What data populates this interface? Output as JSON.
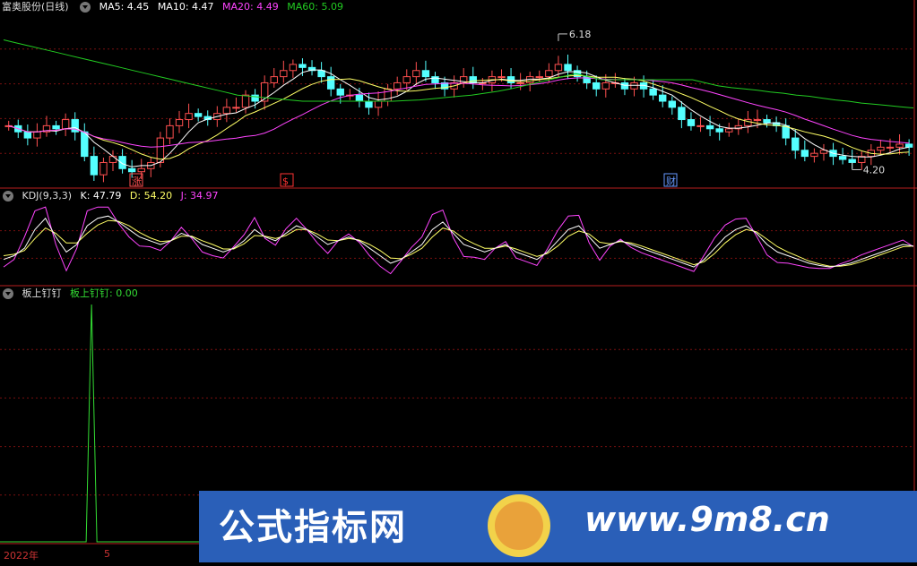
{
  "stock": {
    "name": "富奥股份(日线)"
  },
  "ma": {
    "ma5_label": "MA5: 4.45",
    "ma10_label": "MA10: 4.47",
    "ma20_label": "MA20: 4.49",
    "ma60_label": "MA60: 5.09"
  },
  "kdj": {
    "title": "KDJ(9,3,3)",
    "k_label": "K: 47.79",
    "d_label": "D: 54.20",
    "j_label": "J: 34.97"
  },
  "indicator": {
    "title": "板上钉钉",
    "value_label": "板上钉钉: 0.00"
  },
  "price_markers": {
    "high": "6.18",
    "low": "4.20"
  },
  "event_tags": [
    "涨",
    "$",
    "财"
  ],
  "x_axis": {
    "year": "2022年",
    "month": "5"
  },
  "watermark": {
    "left": "公式指标网",
    "right": "www.9m8.cn"
  },
  "colors": {
    "background": "#000000",
    "up_candle": "#ff5050",
    "down_candle": "#54ffff",
    "ma5": "#ffffff",
    "ma10": "#ffff66",
    "ma20": "#ff44ff",
    "ma60": "#22cc22",
    "kdj_k": "#ffffff",
    "kdj_d": "#ffff66",
    "kdj_j": "#ff44ff",
    "signal": "#33dd33",
    "grid": "#7a1010",
    "panel_border": "#b81e1e"
  },
  "chart_data": {
    "type": "candlestick",
    "price": {
      "close": [
        4.8,
        4.7,
        4.6,
        4.7,
        4.8,
        4.75,
        4.9,
        4.7,
        4.3,
        4.0,
        4.2,
        4.3,
        4.1,
        4.05,
        4.1,
        4.2,
        4.6,
        4.8,
        4.9,
        5.0,
        4.95,
        4.9,
        5.0,
        5.1,
        5.1,
        5.3,
        5.2,
        5.5,
        5.6,
        5.7,
        5.8,
        5.75,
        5.7,
        5.6,
        5.4,
        5.3,
        5.3,
        5.2,
        5.1,
        5.2,
        5.4,
        5.5,
        5.6,
        5.7,
        5.6,
        5.5,
        5.4,
        5.5,
        5.6,
        5.5,
        5.5,
        5.6,
        5.6,
        5.5,
        5.5,
        5.6,
        5.6,
        5.7,
        5.8,
        5.7,
        5.6,
        5.5,
        5.4,
        5.5,
        5.5,
        5.4,
        5.5,
        5.4,
        5.3,
        5.2,
        5.1,
        4.9,
        4.8,
        4.8,
        4.75,
        4.7,
        4.75,
        4.8,
        4.9,
        4.9,
        4.85,
        4.8,
        4.6,
        4.4,
        4.3,
        4.35,
        4.4,
        4.3,
        4.25,
        4.2,
        4.3,
        4.4,
        4.45,
        4.45,
        4.5,
        4.45
      ],
      "ma60": [
        6.2,
        6.15,
        6.1,
        6.05,
        6.0,
        5.95,
        5.9,
        5.85,
        5.8,
        5.75,
        5.7,
        5.65,
        5.6,
        5.55,
        5.5,
        5.45,
        5.4,
        5.35,
        5.3,
        5.28,
        5.26,
        5.24,
        5.22,
        5.2,
        5.2,
        5.2,
        5.2,
        5.2,
        5.2,
        5.2,
        5.2,
        5.21,
        5.22,
        5.24,
        5.26,
        5.28,
        5.3,
        5.33,
        5.36,
        5.4,
        5.45,
        5.5,
        5.55,
        5.6,
        5.65,
        5.6,
        5.55,
        5.55,
        5.55,
        5.55,
        5.55,
        5.55,
        5.55,
        5.55,
        5.5,
        5.45,
        5.42,
        5.4,
        5.38,
        5.35,
        5.33,
        5.3,
        5.28,
        5.25,
        5.22,
        5.2,
        5.17,
        5.15,
        5.13,
        5.11,
        5.09
      ],
      "ylim": [
        3.9,
        6.5
      ],
      "high_marker": 6.18,
      "low_marker": 4.2
    },
    "kdj": {
      "k": [
        30,
        35,
        45,
        70,
        85,
        60,
        40,
        50,
        75,
        85,
        88,
        80,
        70,
        60,
        55,
        50,
        55,
        65,
        60,
        50,
        45,
        40,
        45,
        55,
        70,
        60,
        55,
        65,
        75,
        70,
        60,
        50,
        55,
        60,
        55,
        45,
        35,
        25,
        30,
        40,
        50,
        70,
        80,
        65,
        50,
        45,
        40,
        45,
        50,
        40,
        35,
        30,
        40,
        55,
        70,
        75,
        60,
        45,
        50,
        55,
        50,
        45,
        40,
        35,
        30,
        25,
        20,
        30,
        45,
        60,
        70,
        75,
        65,
        50,
        40,
        35,
        30,
        25,
        22,
        20,
        22,
        25,
        30,
        35,
        40,
        45,
        50,
        48
      ],
      "d": [
        35,
        37,
        42,
        58,
        72,
        65,
        52,
        52,
        65,
        76,
        82,
        81,
        75,
        66,
        59,
        54,
        55,
        61,
        61,
        55,
        50,
        44,
        44,
        51,
        62,
        61,
        58,
        62,
        70,
        70,
        64,
        56,
        55,
        58,
        56,
        50,
        42,
        32,
        31,
        37,
        45,
        60,
        72,
        68,
        58,
        51,
        45,
        45,
        48,
        44,
        39,
        34,
        38,
        48,
        61,
        68,
        64,
        53,
        51,
        54,
        52,
        48,
        43,
        38,
        33,
        28,
        23,
        27,
        38,
        52,
        63,
        70,
        67,
        57,
        47,
        40,
        34,
        28,
        24,
        21,
        21,
        23,
        27,
        32,
        37,
        42,
        47,
        48
      ],
      "j": [
        20,
        30,
        60,
        95,
        100,
        50,
        15,
        45,
        95,
        100,
        100,
        78,
        60,
        48,
        47,
        42,
        55,
        73,
        58,
        40,
        35,
        32,
        47,
        63,
        86,
        58,
        49,
        71,
        85,
        70,
        52,
        38,
        55,
        64,
        53,
        35,
        21,
        11,
        28,
        46,
        60,
        90,
        96,
        59,
        34,
        33,
        30,
        45,
        54,
        32,
        27,
        22,
        44,
        69,
        88,
        89,
        52,
        29,
        48,
        57,
        46,
        39,
        34,
        29,
        24,
        19,
        14,
        36,
        59,
        76,
        84,
        85,
        61,
        36,
        26,
        25,
        22,
        19,
        18,
        18,
        24,
        29,
        36,
        41,
        46,
        51,
        56,
        47
      ],
      "ylim": [
        -5,
        105
      ]
    },
    "signal": {
      "name": "板上钉钉",
      "values": [
        0,
        0,
        0,
        0,
        0,
        0,
        0,
        0,
        0,
        0,
        0,
        0,
        0,
        0,
        0,
        0,
        0,
        0,
        0,
        0,
        0,
        0,
        0,
        0,
        0,
        0,
        0,
        0,
        0,
        0,
        0,
        0,
        0,
        0,
        0,
        0,
        0,
        0,
        0,
        0,
        0,
        0,
        0,
        0,
        0,
        0,
        0,
        0,
        0,
        0,
        0,
        0,
        0,
        0,
        0,
        0,
        0,
        0,
        0,
        0,
        0,
        0,
        0,
        0,
        0,
        0,
        0,
        0,
        0,
        0,
        0,
        0,
        0,
        0,
        0,
        0,
        0,
        0,
        0,
        0,
        0,
        0,
        0,
        0,
        0,
        0,
        0,
        0,
        0,
        0,
        0,
        0,
        0,
        0,
        0,
        0,
        0,
        0,
        0,
        0,
        0,
        0,
        0,
        0,
        0,
        0,
        0,
        0,
        0,
        0,
        0,
        0,
        0,
        0,
        0,
        0,
        0,
        0,
        0,
        0,
        0,
        0,
        0,
        0,
        0,
        0,
        0,
        0,
        0,
        0,
        0,
        0,
        0,
        0,
        0,
        0,
        0,
        0,
        0,
        0,
        0,
        0,
        0,
        0,
        0,
        0,
        0,
        0,
        0,
        0,
        0
      ],
      "spike_index": 10,
      "spike_value": 1
    }
  }
}
